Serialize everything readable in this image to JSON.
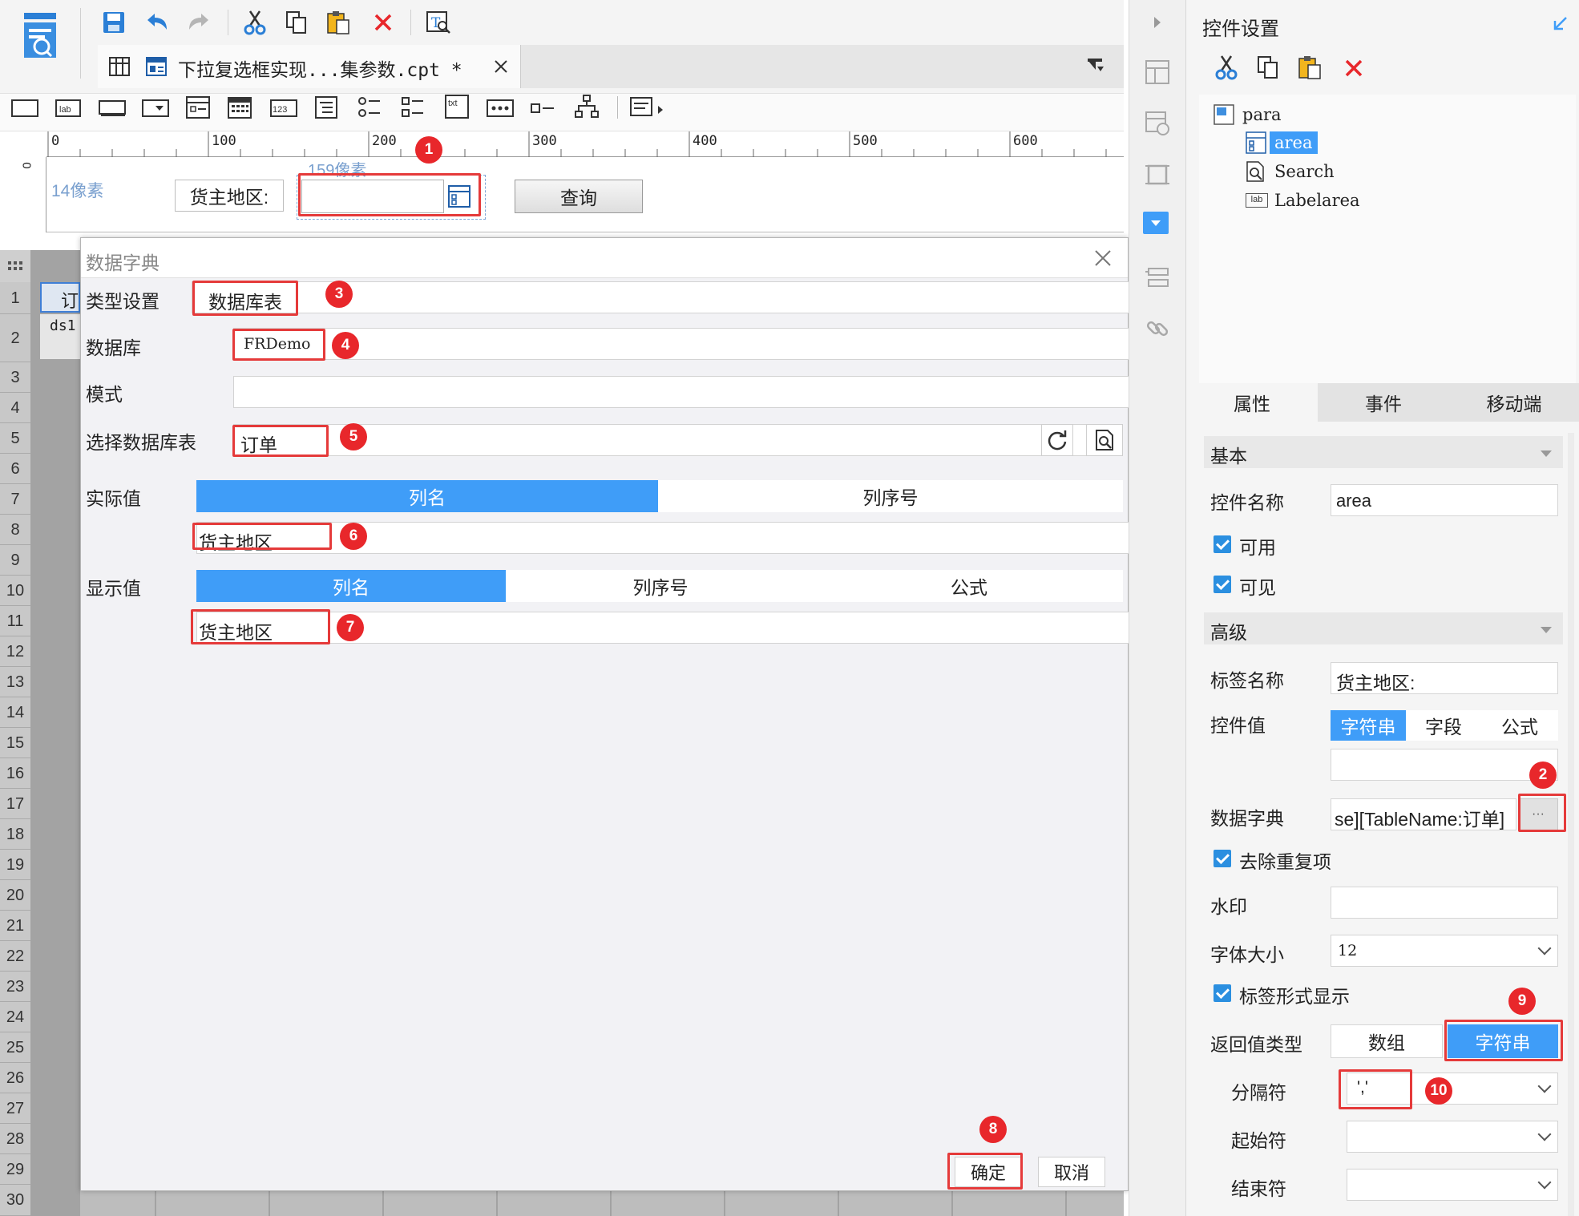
{
  "toolbar": {
    "tab_title": "下拉复选框实现...集参数.cpt *"
  },
  "canvas": {
    "ruler_ticks": [
      "0",
      "100",
      "200",
      "300",
      "400",
      "500",
      "600"
    ],
    "ruler_zero": "0",
    "width_hint": "159像素",
    "height_hint": "14像素",
    "param_label": "货主地区:",
    "query_button": "查询"
  },
  "grid": {
    "rows": [
      "1",
      "2",
      "3",
      "4",
      "5",
      "6",
      "7",
      "8",
      "9",
      "10",
      "11",
      "12",
      "13",
      "14",
      "15",
      "16",
      "17",
      "18",
      "19",
      "20",
      "21",
      "22",
      "23",
      "24",
      "25",
      "26",
      "27",
      "28",
      "29",
      "30"
    ],
    "cell_a1": "订",
    "cell_a2": "ds1"
  },
  "dialog": {
    "title": "数据字典",
    "type_label": "类型设置",
    "type_value": "数据库表",
    "db_label": "数据库",
    "db_value": "FRDemo",
    "schema_label": "模式",
    "table_label": "选择数据库表",
    "table_value": "订单",
    "actual_label": "实际值",
    "actual_tabs": [
      "列名",
      "列序号"
    ],
    "actual_value": "货主地区",
    "display_label": "显示值",
    "display_tabs": [
      "列名",
      "列序号",
      "公式"
    ],
    "display_value": "货主地区",
    "ok": "确定",
    "cancel": "取消"
  },
  "panel": {
    "title": "控件设置",
    "tree": {
      "root": "para",
      "items": [
        "area",
        "Search",
        "Labelarea"
      ],
      "lab_icon_text": "lab"
    },
    "tabs": [
      "属性",
      "事件",
      "移动端"
    ],
    "basic": "基本",
    "name_label": "控件名称",
    "name_value": "area",
    "enabled": "可用",
    "visible": "可见",
    "advanced": "高级",
    "tag_label": "标签名称",
    "tag_value": "货主地区:",
    "value_label": "控件值",
    "value_tabs": [
      "字符串",
      "字段",
      "公式"
    ],
    "dict_label": "数据字典",
    "dict_value": "se][TableName:订单]",
    "dict_button": "···",
    "dedupe": "去除重复项",
    "watermark": "水印",
    "font_label": "字体大小",
    "font_value": "12",
    "tag_display": "标签形式显示",
    "return_label": "返回值类型",
    "return_opts": [
      "数组",
      "字符串"
    ],
    "sep_label": "分隔符",
    "sep_value": "','",
    "start_label": "起始符",
    "end_label": "结束符"
  },
  "badges": [
    "1",
    "2",
    "3",
    "4",
    "5",
    "6",
    "7",
    "8",
    "9",
    "10"
  ],
  "colors": {
    "accent": "#3f9df8",
    "annotation": "#e53a3a",
    "badge": "#e8272b"
  }
}
